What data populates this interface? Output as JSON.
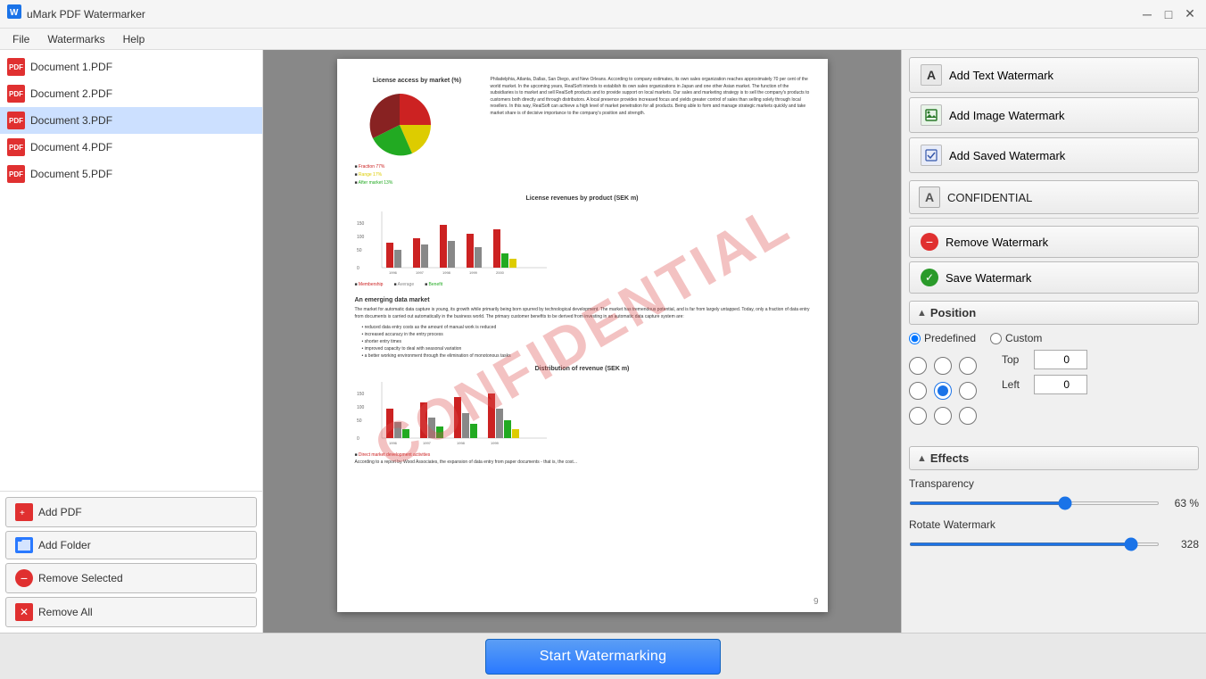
{
  "app": {
    "title": "uMark PDF Watermarker",
    "icon": "💧"
  },
  "titlebar": {
    "minimize": "─",
    "maximize": "□",
    "close": "✕"
  },
  "menu": {
    "items": [
      "File",
      "Watermarks",
      "Help"
    ]
  },
  "sidebar": {
    "files": [
      {
        "name": "Document 1.PDF",
        "selected": false
      },
      {
        "name": "Document 2.PDF",
        "selected": false
      },
      {
        "name": "Document 3.PDF",
        "selected": true
      },
      {
        "name": "Document 4.PDF",
        "selected": false
      },
      {
        "name": "Document 5.PDF",
        "selected": false
      }
    ],
    "buttons": {
      "add_pdf": "Add PDF",
      "add_folder": "Add Folder",
      "remove_selected": "Remove Selected",
      "remove_all": "Remove All"
    }
  },
  "preview": {
    "watermark_text": "CONFIDENTIAL",
    "page_number": "9"
  },
  "right_panel": {
    "add_text_label": "Add Text Watermark",
    "add_image_label": "Add Image Watermark",
    "add_saved_label": "Add Saved Watermark",
    "watermark_item": "CONFIDENTIAL",
    "remove_watermark": "Remove Watermark",
    "save_watermark": "Save Watermark",
    "position_section": "Position",
    "predefined_label": "Predefined",
    "custom_label": "Custom",
    "top_label": "Top",
    "left_label": "Left",
    "top_value": "0",
    "left_value": "0",
    "effects_section": "Effects",
    "transparency_label": "Transparency",
    "transparency_value": "63 %",
    "rotate_label": "Rotate Watermark",
    "rotate_value": "328"
  },
  "bottom": {
    "start_btn": "Start Watermarking"
  }
}
